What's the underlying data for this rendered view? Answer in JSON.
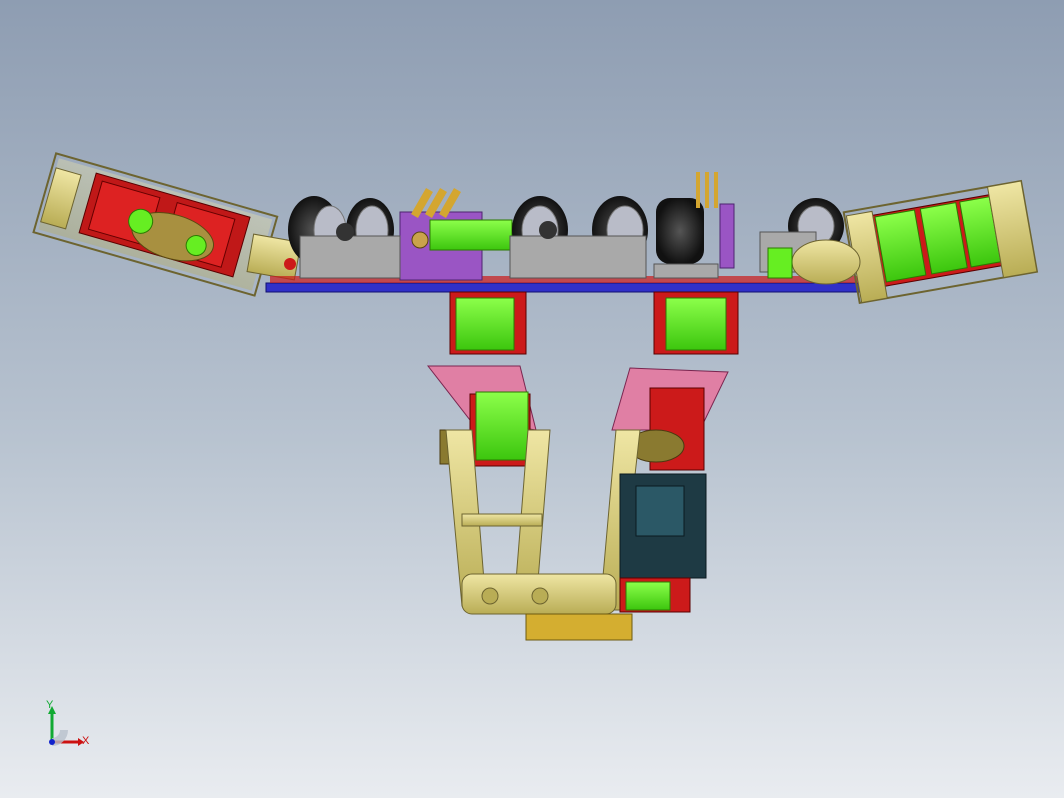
{
  "viewport": {
    "background_top": "#8e9db2",
    "background_bottom": "#e9ecf0"
  },
  "model": {
    "colors": {
      "bracket_gold": "#d9cf7c",
      "servo_green": "#66ee22",
      "servo_red": "#cc1a1a",
      "base_plate_blue": "#3030c8",
      "link_pink": "#e07fa4",
      "bracket_purple": "#9a55c4",
      "wheel_black": "#222428",
      "wheel_hub": "#b9bcc8",
      "caster_grey": "#a9a9a9",
      "board_dark": "#1e3a44"
    },
    "icons": [
      "mechanical-assembly-icon"
    ]
  },
  "triad": {
    "x_label": "X",
    "y_label": "Y",
    "x_color": "#cc1111",
    "y_color": "#11aa33",
    "z_color": "#1122cc"
  }
}
